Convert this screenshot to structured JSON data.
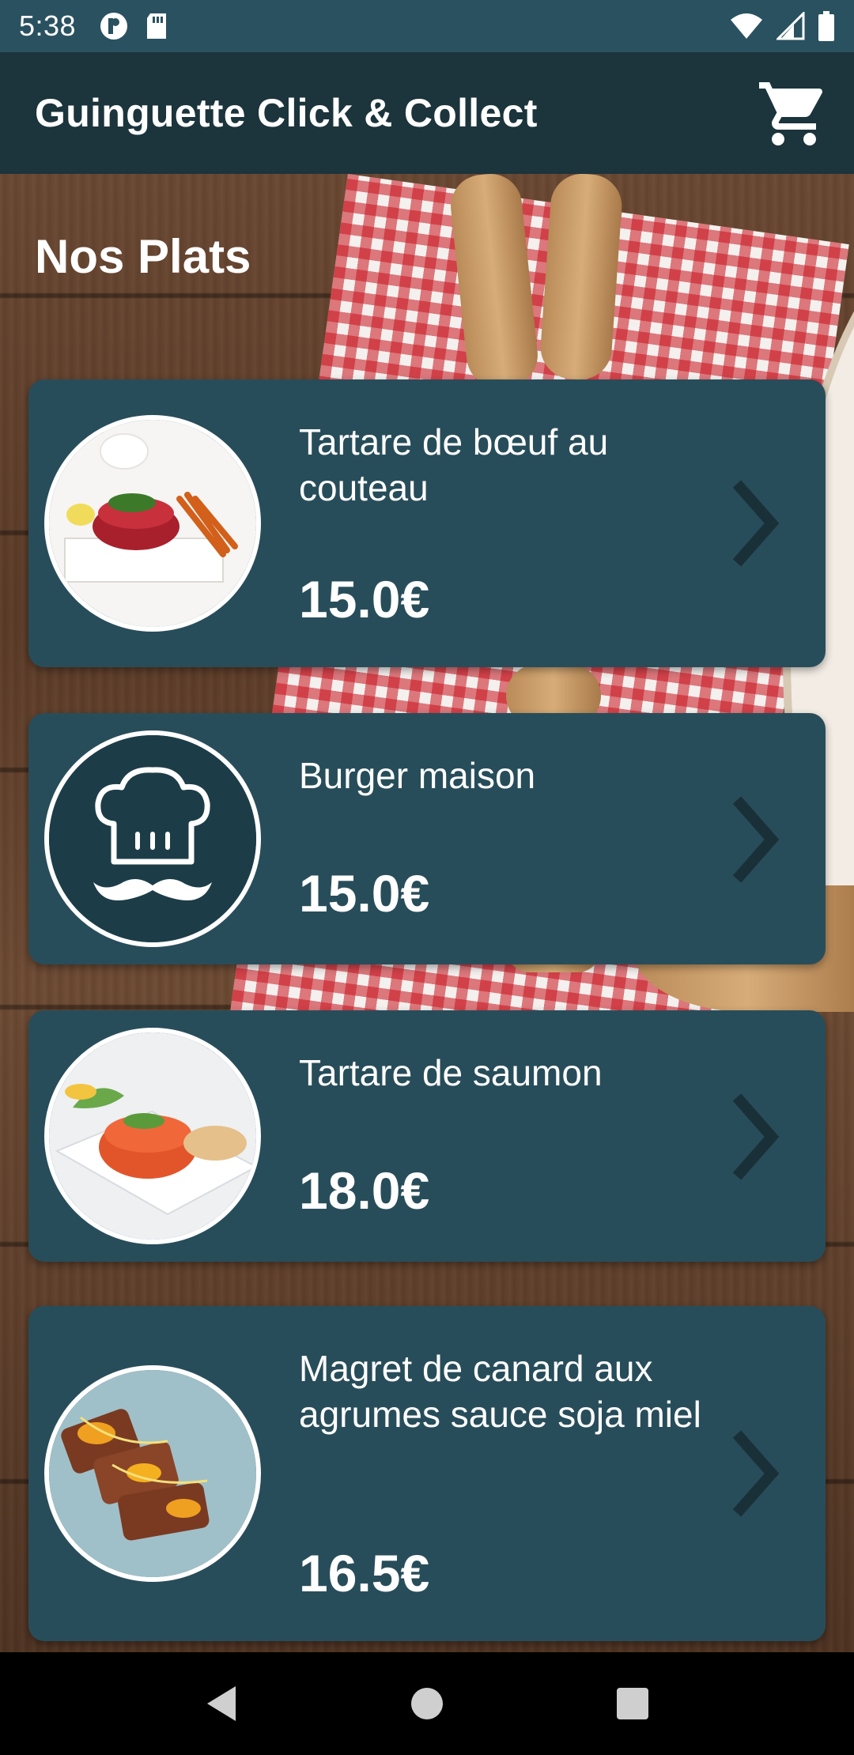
{
  "status_bar": {
    "time": "5:38"
  },
  "app_bar": {
    "title": "Guinguette Click & Collect",
    "cart_icon": "shopping-cart-icon"
  },
  "page": {
    "title": "Nos Plats"
  },
  "dishes": [
    {
      "name": "Tartare de bœuf au couteau",
      "price": "15.0€",
      "image": "beef-tartare-photo"
    },
    {
      "name": "Burger maison",
      "price": "15.0€",
      "image": "chef-placeholder-icon"
    },
    {
      "name": "Tartare de saumon",
      "price": "18.0€",
      "image": "salmon-tartare-photo"
    },
    {
      "name": "Magret de canard aux agrumes sauce soja miel",
      "price": "16.5€",
      "image": "duck-breast-photo"
    }
  ],
  "colors": {
    "card": "#284d5a",
    "app_bar": "#1c343c",
    "status_bar": "#2a5160",
    "chevron": "#1a3038"
  },
  "nav": {
    "back_icon": "back-triangle-icon",
    "home_icon": "home-circle-icon",
    "recents_icon": "recents-square-icon"
  }
}
